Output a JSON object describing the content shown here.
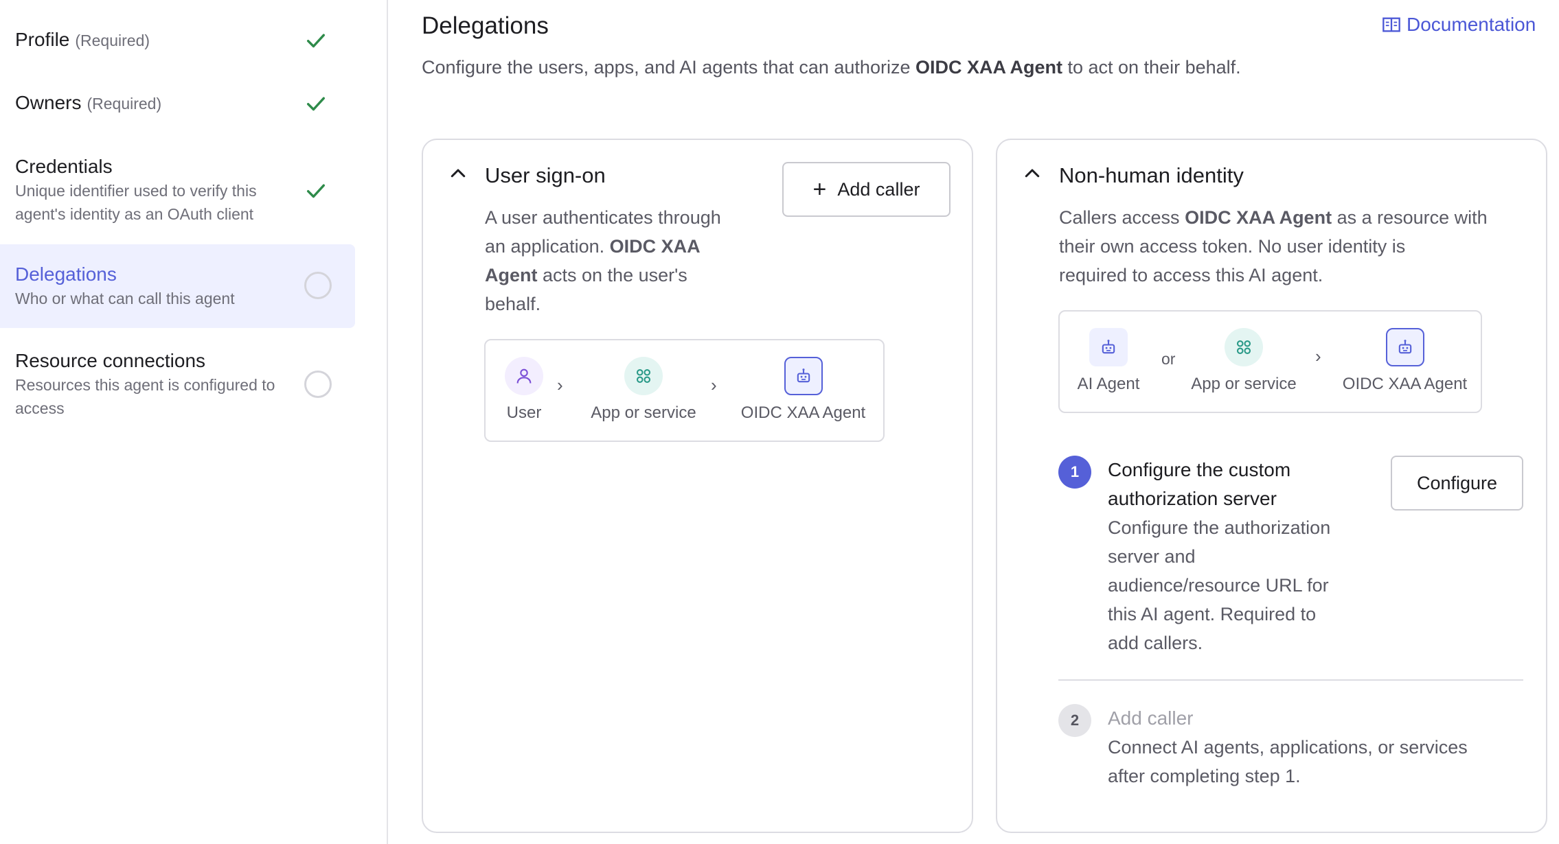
{
  "sidebar": {
    "steps": [
      {
        "title": "Profile",
        "required": "(Required)",
        "status": "complete"
      },
      {
        "title": "Owners",
        "required": "(Required)",
        "status": "complete"
      },
      {
        "title": "Credentials",
        "description": "Unique identifier used to verify this agent's identity as an OAuth client",
        "status": "complete"
      },
      {
        "title": "Delegations",
        "description": "Who or what can call this agent",
        "status": "incomplete",
        "active": true
      },
      {
        "title": "Resource connections",
        "description": "Resources this agent is configured to access",
        "status": "incomplete"
      }
    ]
  },
  "header": {
    "title": "Delegations",
    "doc_link": "Documentation",
    "subtitle_pre": "Configure the users, apps, and AI agents that can authorize ",
    "subtitle_bold": "OIDC XAA Agent",
    "subtitle_post": " to act on their behalf."
  },
  "user_signon": {
    "title": "User sign-on",
    "add_caller": "Add caller",
    "desc_line1": "A user authenticates through",
    "desc_line2_pre": "an application. ",
    "desc_line2_bold": "OIDC XAA",
    "desc_line3_bold": "Agent",
    "desc_line3_post": " acts on the user's",
    "desc_line4": "behalf.",
    "flow": {
      "user": "User",
      "app": "App or service",
      "agent": "OIDC XAA Agent"
    }
  },
  "non_human": {
    "title": "Non-human identity",
    "desc_line1_pre": "Callers access ",
    "desc_line1_bold": "OIDC XAA Agent",
    "desc_line1_post": " as a resource with",
    "desc_line2": "their own access token. No user identity is",
    "desc_line3": "required to access this AI agent.",
    "flow": {
      "ai_agent": "AI Agent",
      "or": "or",
      "app": "App or service",
      "agent": "OIDC XAA Agent"
    },
    "steps": [
      {
        "number": "1",
        "title_line1": "Configure the custom",
        "title_line2": "authorization server",
        "desc_lines": [
          "Configure the authorization",
          "server and",
          "audience/resource URL for",
          "this AI agent. Required to",
          "add callers."
        ],
        "button": "Configure"
      },
      {
        "number": "2",
        "title": "Add caller",
        "desc_lines": [
          "Connect AI agents, applications, or services",
          "after completing step 1."
        ]
      }
    ]
  },
  "colors": {
    "accent": "#5560d8",
    "success": "#2e8b4a",
    "active_bg": "#eef0ff"
  }
}
